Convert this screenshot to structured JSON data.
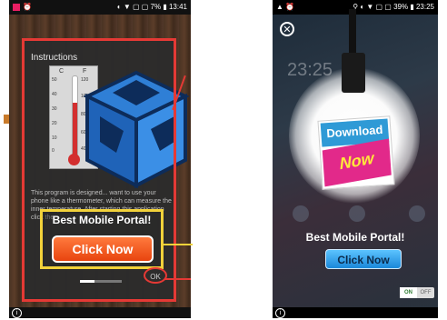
{
  "left": {
    "status_time": "13:41",
    "status_battery": "7%",
    "instructions_title": "Instructions",
    "thermo_c": "C",
    "thermo_f": "F",
    "scale_c": [
      "50",
      "40",
      "30",
      "20",
      "10",
      "0"
    ],
    "scale_f": [
      "120",
      "100",
      "80",
      "60",
      "40"
    ],
    "instructions_text": "This program is designed... want to use your phone like a thermometer, which can measure the inner temperature. After starting this application click the...",
    "banner_title": "Best Mobile Portal!",
    "click_label": "Click Now",
    "ok_label": "OK",
    "progress": 0.35
  },
  "right": {
    "status_time": "23:25",
    "status_battery": "39%",
    "close_glyph": "✕",
    "clock_text": "23:25",
    "download_word": "Download",
    "now_word": "Now",
    "banner_title": "Best Mobile Portal!",
    "click_label": "Click Now",
    "toggle_on": "ON",
    "toggle_off": "OFF"
  },
  "colors": {
    "highlight_red": "#e53935",
    "highlight_yellow": "#f2d23a",
    "click_orange": "#e8440f",
    "click_blue": "#1a88d9"
  }
}
